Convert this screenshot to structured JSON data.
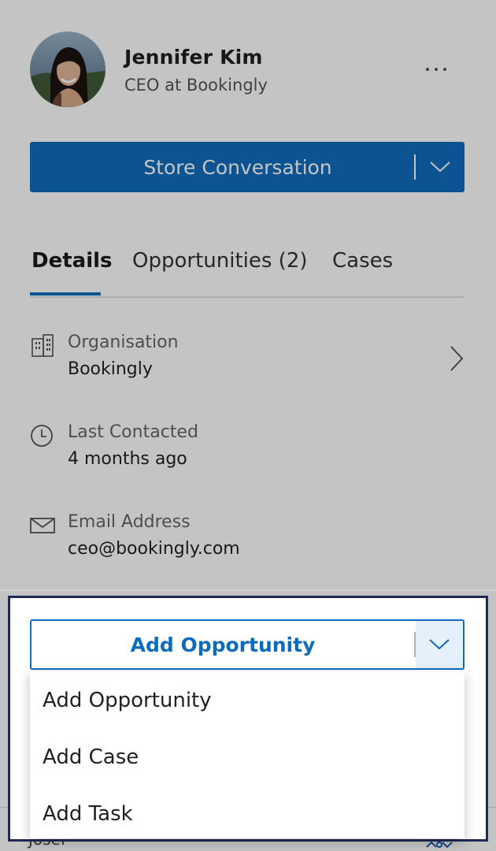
{
  "contact": {
    "name": "Jennifer Kim",
    "subtitle": "CEO at Bookingly"
  },
  "header": {
    "more_icon": "more-horizontal-icon"
  },
  "primary_action": {
    "label": "Store Conversation",
    "color": "#0f6cbd"
  },
  "tabs": [
    {
      "label": "Details",
      "active": true
    },
    {
      "label": "Opportunities (2)",
      "active": false
    },
    {
      "label": "Cases",
      "active": false
    }
  ],
  "details": [
    {
      "icon": "building-icon",
      "label": "Organisation",
      "value": "Bookingly"
    },
    {
      "icon": "clock-icon",
      "label": "Last Contacted",
      "value": "4 months ago"
    },
    {
      "icon": "mail-icon",
      "label": "Email Address",
      "value": "ceo@bookingly.com"
    }
  ],
  "bottom_peek": {
    "text": "Josef"
  },
  "action_panel": {
    "button_label": "Add Opportunity",
    "menu": [
      "Add Opportunity",
      "Add Case",
      "Add Task"
    ],
    "frame_color": "#1e2a55"
  }
}
